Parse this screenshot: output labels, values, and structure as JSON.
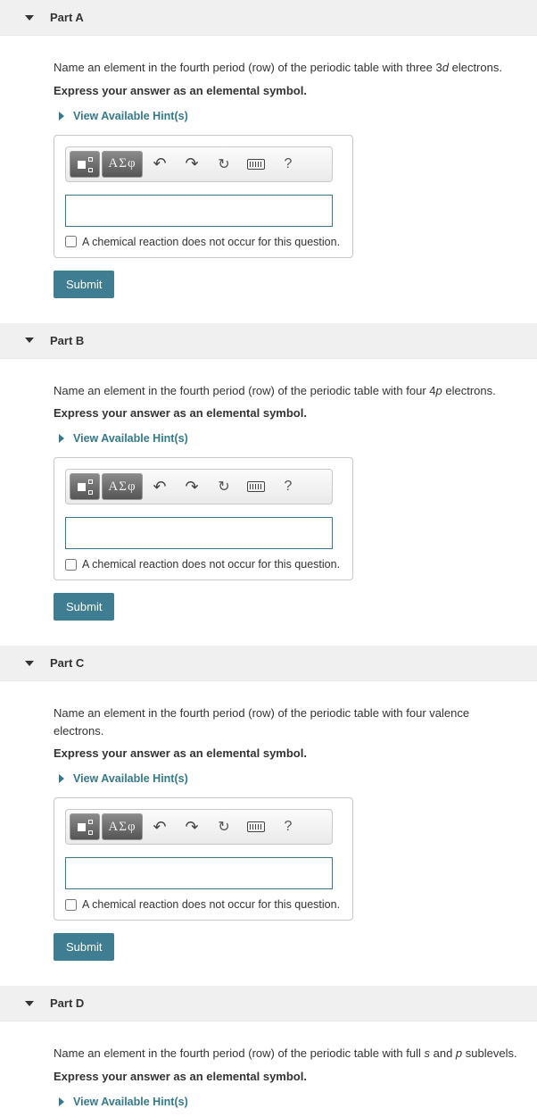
{
  "common": {
    "hints_label": "View Available Hint(s)",
    "instruction": "Express your answer as an elemental symbol.",
    "greek_label": "ΑΣφ",
    "help_label": "?",
    "checkbox_label": "A chemical reaction does not occur for this question.",
    "submit_label": "Submit"
  },
  "parts": {
    "a": {
      "title": "Part A",
      "question_pre": "Name an element in the fourth period (row) of the periodic table with three 3",
      "question_italic": "d",
      "question_post": " electrons.",
      "answer_value": ""
    },
    "b": {
      "title": "Part B",
      "question_pre": "Name an element in the fourth period (row) of the periodic table with four 4",
      "question_italic": "p",
      "question_post": " electrons.",
      "answer_value": ""
    },
    "c": {
      "title": "Part C",
      "question_full": "Name an element in the fourth period (row) of the periodic table with four valence electrons.",
      "answer_value": ""
    },
    "d": {
      "title": "Part D",
      "question_pre": "Name an element in the fourth period (row) of the periodic table with full ",
      "question_italic1": "s",
      "question_mid": " and ",
      "question_italic2": "p",
      "question_post": " sublevels."
    }
  }
}
